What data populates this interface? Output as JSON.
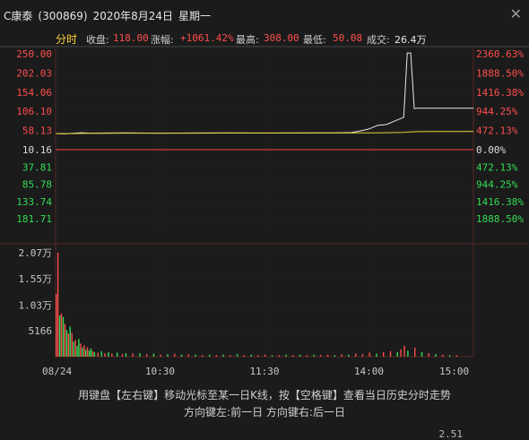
{
  "window": {
    "stock_name": "C康泰",
    "stock_code": "(300869)",
    "date": "2020年8月24日",
    "weekday": "星期一",
    "close_icon": "close-icon"
  },
  "info_bar": {
    "tab_label": "分时",
    "close_label": "收盘:",
    "close_value": "118.00",
    "change_label": "涨幅:",
    "change_value": "+1061.42%",
    "high_label": "最高:",
    "high_value": "308.00",
    "low_label": "最低:",
    "low_value": "50.08",
    "volume_label": "成交:",
    "volume_value": "26.4万"
  },
  "hints": {
    "line1": "用键盘【左右键】移动光标至某一日K线，按【空格键】查看当日历史分时走势",
    "line2": "方向键左:前一日   方向键右:后一日"
  },
  "corner_value": "2.51",
  "colors": {
    "background": "#1b1b1b",
    "grid": "#3a1e1e",
    "up": "#ff4d4d",
    "down": "#33dd55",
    "price_line": "#e8e8e8",
    "avg_line": "#e5d23a",
    "axis_text": "#c8c8c8"
  },
  "chart_data": [
    {
      "type": "line",
      "name": "price",
      "price_axis_left": {
        "up": [
          "250.00",
          "202.03",
          "154.06",
          "106.10",
          "58.13"
        ],
        "mid": "10.16",
        "down": [
          "37.81",
          "85.78",
          "133.74",
          "181.71"
        ]
      },
      "pct_axis_right": {
        "up": [
          "2360.63%",
          "1888.50%",
          "1416.38%",
          "944.25%",
          "472.13%"
        ],
        "mid": "0.00%",
        "down": [
          "472.13%",
          "944.25%",
          "1416.38%",
          "1888.50%"
        ]
      },
      "ylim": [
        10.16,
        250
      ],
      "x_ticks": [
        "08/24",
        "10:30",
        "11:30",
        "14:00",
        "15:00"
      ],
      "x": [
        0,
        5,
        10,
        15,
        20,
        30,
        40,
        60,
        80,
        100,
        120,
        140,
        160,
        170,
        175,
        180,
        185,
        190,
        196,
        200,
        202,
        204,
        206,
        208,
        210,
        215,
        225,
        235,
        240
      ],
      "price": [
        50.5,
        49.5,
        51,
        52.5,
        51.5,
        51.8,
        52,
        51.5,
        51.8,
        52,
        51.8,
        52,
        52,
        53,
        57,
        62,
        71,
        73,
        84,
        91,
        252,
        252,
        113,
        114,
        114,
        114,
        114,
        114,
        114
      ],
      "avg": [
        50.5,
        50.2,
        50.4,
        50.8,
        51,
        51.2,
        51.3,
        51.4,
        51.5,
        51.6,
        51.6,
        51.7,
        51.8,
        51.9,
        52,
        52.1,
        52.3,
        52.5,
        53,
        53.3,
        54,
        54.5,
        55,
        55.2,
        55.3,
        55.5,
        55.6,
        55.7,
        55.8
      ]
    },
    {
      "type": "bar",
      "name": "volume",
      "y_ticks": [
        "2.07万",
        "1.55万",
        "1.03万",
        "5166"
      ],
      "ylim": [
        0,
        20700
      ],
      "bars": [
        {
          "x": 0,
          "v": 12500,
          "c": "up"
        },
        {
          "x": 1,
          "v": 20700,
          "c": "up"
        },
        {
          "x": 2,
          "v": 8200,
          "c": "down"
        },
        {
          "x": 3,
          "v": 8600,
          "c": "up"
        },
        {
          "x": 4,
          "v": 7900,
          "c": "down"
        },
        {
          "x": 5,
          "v": 6500,
          "c": "up"
        },
        {
          "x": 6,
          "v": 5300,
          "c": "down"
        },
        {
          "x": 7,
          "v": 4600,
          "c": "up"
        },
        {
          "x": 8,
          "v": 6000,
          "c": "down"
        },
        {
          "x": 9,
          "v": 4700,
          "c": "up"
        },
        {
          "x": 10,
          "v": 3000,
          "c": "down"
        },
        {
          "x": 11,
          "v": 3300,
          "c": "up"
        },
        {
          "x": 12,
          "v": 2100,
          "c": "down"
        },
        {
          "x": 13,
          "v": 3500,
          "c": "down"
        },
        {
          "x": 14,
          "v": 2600,
          "c": "up"
        },
        {
          "x": 15,
          "v": 1800,
          "c": "down"
        },
        {
          "x": 16,
          "v": 2300,
          "c": "up"
        },
        {
          "x": 17,
          "v": 1400,
          "c": "down"
        },
        {
          "x": 18,
          "v": 1900,
          "c": "up"
        },
        {
          "x": 19,
          "v": 1200,
          "c": "down"
        },
        {
          "x": 20,
          "v": 1600,
          "c": "down"
        },
        {
          "x": 21,
          "v": 1100,
          "c": "up"
        },
        {
          "x": 22,
          "v": 900,
          "c": "down"
        },
        {
          "x": 24,
          "v": 800,
          "c": "up"
        },
        {
          "x": 26,
          "v": 1100,
          "c": "down"
        },
        {
          "x": 28,
          "v": 700,
          "c": "up"
        },
        {
          "x": 30,
          "v": 900,
          "c": "down"
        },
        {
          "x": 32,
          "v": 600,
          "c": "up"
        },
        {
          "x": 35,
          "v": 800,
          "c": "down"
        },
        {
          "x": 38,
          "v": 500,
          "c": "up"
        },
        {
          "x": 40,
          "v": 700,
          "c": "down"
        },
        {
          "x": 44,
          "v": 600,
          "c": "up"
        },
        {
          "x": 48,
          "v": 700,
          "c": "down"
        },
        {
          "x": 52,
          "v": 500,
          "c": "up"
        },
        {
          "x": 56,
          "v": 600,
          "c": "down"
        },
        {
          "x": 60,
          "v": 400,
          "c": "up"
        },
        {
          "x": 64,
          "v": 500,
          "c": "down"
        },
        {
          "x": 68,
          "v": 600,
          "c": "up"
        },
        {
          "x": 72,
          "v": 400,
          "c": "down"
        },
        {
          "x": 76,
          "v": 500,
          "c": "up"
        },
        {
          "x": 80,
          "v": 400,
          "c": "down"
        },
        {
          "x": 84,
          "v": 300,
          "c": "up"
        },
        {
          "x": 88,
          "v": 400,
          "c": "down"
        },
        {
          "x": 92,
          "v": 300,
          "c": "up"
        },
        {
          "x": 96,
          "v": 400,
          "c": "down"
        },
        {
          "x": 100,
          "v": 300,
          "c": "up"
        },
        {
          "x": 104,
          "v": 500,
          "c": "down"
        },
        {
          "x": 108,
          "v": 300,
          "c": "up"
        },
        {
          "x": 112,
          "v": 400,
          "c": "down"
        },
        {
          "x": 116,
          "v": 300,
          "c": "up"
        },
        {
          "x": 120,
          "v": 400,
          "c": "up"
        },
        {
          "x": 124,
          "v": 300,
          "c": "down"
        },
        {
          "x": 128,
          "v": 300,
          "c": "up"
        },
        {
          "x": 132,
          "v": 400,
          "c": "down"
        },
        {
          "x": 136,
          "v": 300,
          "c": "up"
        },
        {
          "x": 140,
          "v": 400,
          "c": "down"
        },
        {
          "x": 144,
          "v": 300,
          "c": "up"
        },
        {
          "x": 148,
          "v": 400,
          "c": "down"
        },
        {
          "x": 152,
          "v": 300,
          "c": "up"
        },
        {
          "x": 156,
          "v": 400,
          "c": "up"
        },
        {
          "x": 160,
          "v": 300,
          "c": "down"
        },
        {
          "x": 164,
          "v": 500,
          "c": "up"
        },
        {
          "x": 168,
          "v": 400,
          "c": "down"
        },
        {
          "x": 172,
          "v": 600,
          "c": "up"
        },
        {
          "x": 176,
          "v": 500,
          "c": "up"
        },
        {
          "x": 180,
          "v": 800,
          "c": "up"
        },
        {
          "x": 184,
          "v": 600,
          "c": "down"
        },
        {
          "x": 188,
          "v": 900,
          "c": "up"
        },
        {
          "x": 192,
          "v": 1100,
          "c": "up"
        },
        {
          "x": 196,
          "v": 900,
          "c": "down"
        },
        {
          "x": 198,
          "v": 1500,
          "c": "up"
        },
        {
          "x": 200,
          "v": 2200,
          "c": "up"
        },
        {
          "x": 202,
          "v": 1200,
          "c": "down"
        },
        {
          "x": 206,
          "v": 1800,
          "c": "up"
        },
        {
          "x": 210,
          "v": 900,
          "c": "down"
        },
        {
          "x": 214,
          "v": 700,
          "c": "up"
        },
        {
          "x": 218,
          "v": 500,
          "c": "down"
        },
        {
          "x": 222,
          "v": 400,
          "c": "up"
        },
        {
          "x": 226,
          "v": 300,
          "c": "down"
        },
        {
          "x": 230,
          "v": 300,
          "c": "up"
        }
      ]
    }
  ]
}
